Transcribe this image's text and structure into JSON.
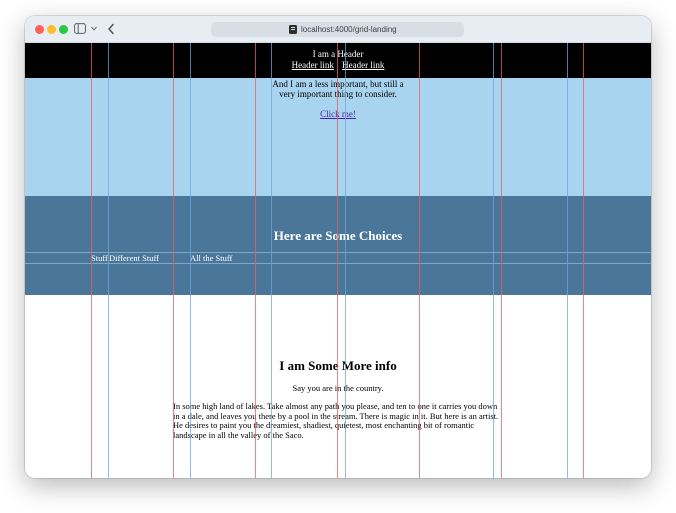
{
  "browser": {
    "url": "localhost:4000/grid-landing",
    "icons": [
      "close-dot",
      "minimize-dot",
      "maximize-dot",
      "sidebar-icon",
      "chevron-down-icon",
      "back-chevron-icon",
      "page-icon"
    ]
  },
  "header": {
    "title": "I am a Header",
    "links": [
      "Header link",
      "Header link"
    ]
  },
  "hero": {
    "text": "And I am a less important, but still a very important thing to consider.",
    "link": "Click me!"
  },
  "choices": {
    "title": "Here are Some Choices",
    "items": [
      "Stuff",
      "Different Stuff",
      "All the Stuff"
    ]
  },
  "info": {
    "title": "I am Some More info",
    "subtitle": "Say you are in the country.",
    "paragraph": "In some high land of lakes. Take almost any path you please, and ten to one it carries you down in a dale, and leaves you there by a pool in the stream. There is magic in it. But here is an artist. He desires to paint you the dreamiest, shadiest, quietest, most enchanting bit of romantic landscape in all the valley of the Saco."
  },
  "colors": {
    "header_bg": "#000000",
    "hero_bg": "#a9d4f0",
    "choices_bg": "#4a7699",
    "info_bg": "#ffffff",
    "grid_red": "#ec5e5e",
    "grid_blue": "#6ea5dc",
    "link": "#4b1f9c"
  }
}
